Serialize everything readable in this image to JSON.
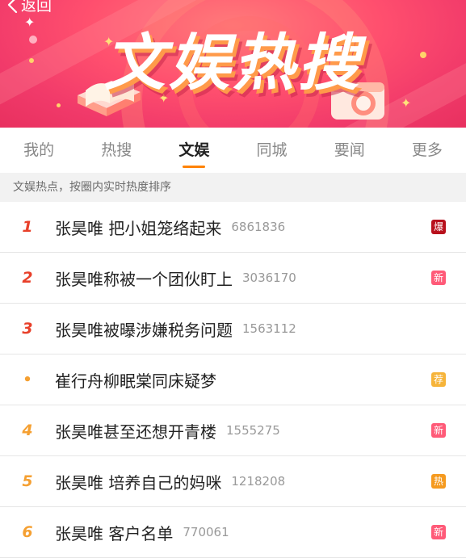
{
  "header": {
    "back_label": "返回",
    "banner_title": "文娱热搜"
  },
  "tabs": [
    {
      "label": "我的",
      "active": false
    },
    {
      "label": "热搜",
      "active": false
    },
    {
      "label": "文娱",
      "active": true
    },
    {
      "label": "同城",
      "active": false
    },
    {
      "label": "要闻",
      "active": false
    },
    {
      "label": "更多",
      "active": false
    }
  ],
  "section": {
    "header_text": "文娱热点，按圈内实时热度排序"
  },
  "list": [
    {
      "rank": "1",
      "title": "张昊唯 把小姐笼络起来",
      "count": "6861836",
      "badge": "爆",
      "badge_color": "#b8101c",
      "rank_color": "red"
    },
    {
      "rank": "2",
      "title": "张昊唯称被一个团伙盯上",
      "count": "3036170",
      "badge": "新",
      "badge_color": "#ff5a78",
      "rank_color": "red"
    },
    {
      "rank": "3",
      "title": "张昊唯被曝涉嫌税务问题",
      "count": "1563112",
      "badge": "",
      "badge_color": "",
      "rank_color": "red"
    },
    {
      "rank": "•",
      "title": "崔行舟柳眠棠同床疑梦",
      "count": "",
      "badge": "荐",
      "badge_color": "#f6b43a",
      "rank_color": "bullet"
    },
    {
      "rank": "4",
      "title": "张昊唯甚至还想开青楼",
      "count": "1555275",
      "badge": "新",
      "badge_color": "#ff5a78",
      "rank_color": "orange"
    },
    {
      "rank": "5",
      "title": "张昊唯 培养自己的妈咪",
      "count": "1218208",
      "badge": "热",
      "badge_color": "#f59a1f",
      "rank_color": "orange"
    },
    {
      "rank": "6",
      "title": "张昊唯 客户名单",
      "count": "770061",
      "badge": "新",
      "badge_color": "#ff5a78",
      "rank_color": "orange"
    }
  ],
  "icons": {
    "back": "chevron-left-icon",
    "more": "more-dots-icon"
  }
}
